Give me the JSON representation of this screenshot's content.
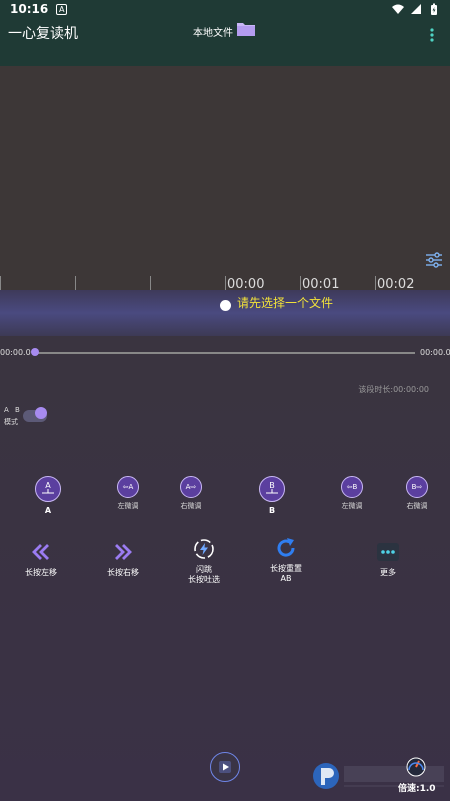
{
  "status_bar": {
    "time": "10:16",
    "badge": "A"
  },
  "toolbar": {
    "title": "一心复读机",
    "local_file_label": "本地文件"
  },
  "timeline": {
    "labels": [
      "00:00",
      "00:01",
      "00:02"
    ]
  },
  "waveform": {
    "message": "请先选择一个文件"
  },
  "seekbar": {
    "start": "00:00.0",
    "end": "00:00.0",
    "progress": 0
  },
  "segment_duration": "该段时长:00:00:00",
  "ab_mode": {
    "letters": "A B",
    "label": "模式",
    "enabled": true
  },
  "ab_controls": [
    {
      "icon_text": "A",
      "label": "A"
    },
    {
      "icon_text": "⇦A",
      "label": "左微调"
    },
    {
      "icon_text": "A⇨",
      "label": "右微调"
    },
    {
      "icon_text": "B",
      "label": "B"
    },
    {
      "icon_text": "⇦B",
      "label": "左微调"
    },
    {
      "icon_text": "B⇨",
      "label": "右微调"
    }
  ],
  "actions": [
    {
      "label": "长按左移"
    },
    {
      "label": "长按右移"
    },
    {
      "label_line1": "闪跳",
      "label_line2": "长按吐选"
    },
    {
      "label_line1": "长按重置",
      "label_line2": "AB"
    },
    {
      "label": "更多"
    }
  ],
  "bottom": {
    "speed": "倍速:1.0"
  },
  "colors": {
    "toolbar_bg": "#1f3a35",
    "accent": "#a78bf0",
    "warning_text": "#f2e23a",
    "ab_button": "#5b3f9f"
  }
}
